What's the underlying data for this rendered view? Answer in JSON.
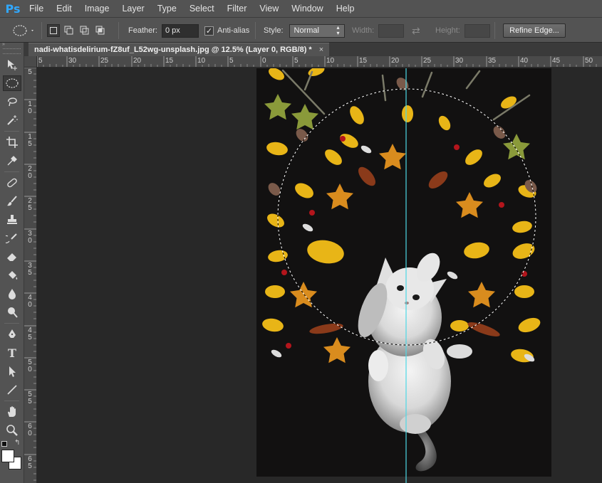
{
  "app": {
    "logo": "Ps"
  },
  "menu": [
    "File",
    "Edit",
    "Image",
    "Layer",
    "Type",
    "Select",
    "Filter",
    "View",
    "Window",
    "Help"
  ],
  "options": {
    "feather_label": "Feather:",
    "feather_value": "0 px",
    "antialias_label": "Anti-alias",
    "antialias_checked": true,
    "style_label": "Style:",
    "style_value": "Normal",
    "width_label": "Width:",
    "height_label": "Height:",
    "refine_edge_label": "Refine Edge..."
  },
  "document": {
    "tab_title": "nadi-whatisdelirium-fZ8uf_L52wg-unsplash.jpg @ 12.5% (Layer 0, RGB/8) *",
    "close_glyph": "×"
  },
  "rulers": {
    "horizontal": [
      "5",
      "30",
      "25",
      "20",
      "15",
      "10",
      "5",
      "0",
      "5",
      "10",
      "15",
      "20",
      "25",
      "30",
      "35",
      "40",
      "45",
      "50"
    ],
    "vertical": [
      "5",
      "1 0",
      "1 5",
      "2 0",
      "2 5",
      "3 0",
      "3 5",
      "4 0",
      "4 5",
      "5 0",
      "5 5",
      "6 0",
      "6 5"
    ]
  },
  "tools": [
    "move-tool-icon",
    "elliptical-marquee-tool-icon",
    "lasso-tool-icon",
    "magic-wand-tool-icon",
    "crop-tool-icon",
    "eyedropper-tool-icon",
    "spot-healing-brush-icon",
    "brush-tool-icon",
    "clone-stamp-tool-icon",
    "history-brush-icon",
    "eraser-tool-icon",
    "paint-bucket-icon",
    "blur-tool-icon",
    "dodge-tool-icon",
    "pen-tool-icon",
    "type-tool-icon",
    "path-selection-tool-icon",
    "line-tool-icon",
    "hand-tool-icon",
    "zoom-tool-icon"
  ],
  "colors": {
    "ps_blue": "#31a8ff",
    "guide": "#4dd9e6",
    "leaf_yellow": "#e8b517",
    "leaf_orange": "#d98c1e",
    "berry": "#b3151c"
  }
}
